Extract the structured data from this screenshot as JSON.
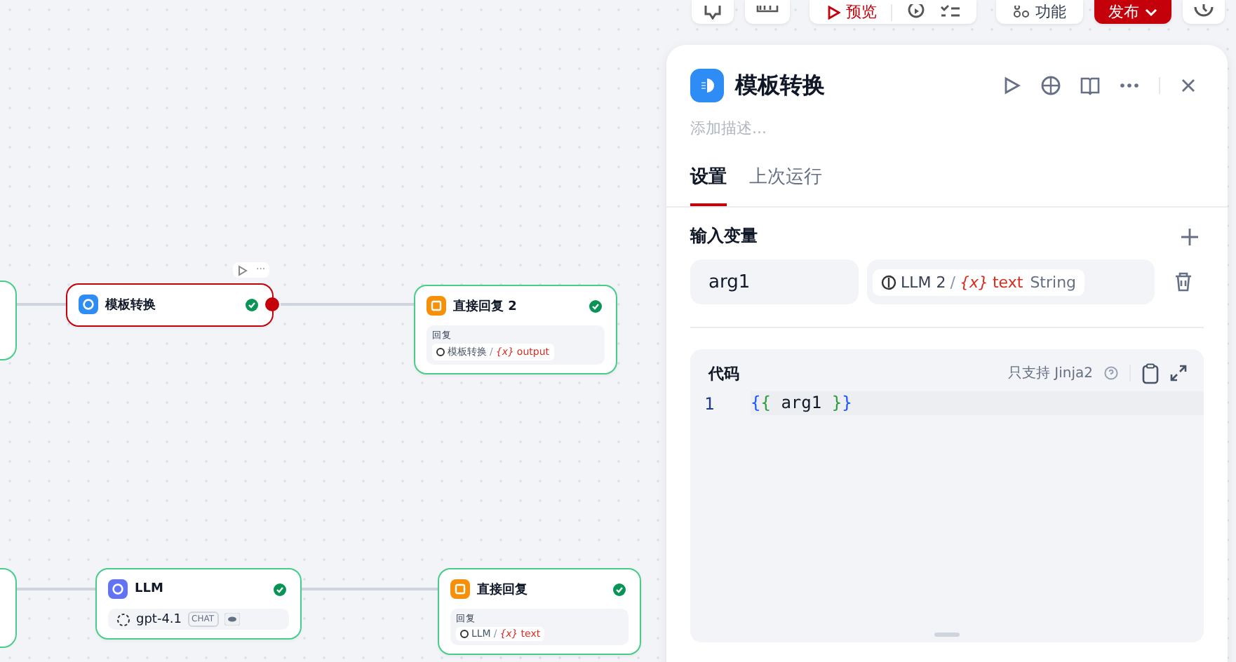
{
  "toolbar": [
    {
      "kind": "chat"
    },
    {
      "kind": "env"
    },
    {
      "kind": "preview",
      "label": "预览"
    },
    {
      "kind": "feature",
      "label": "功能"
    },
    {
      "kind": "publish",
      "label": "发布"
    },
    {
      "kind": "history"
    }
  ],
  "nodes": [
    {
      "title": "模板转换",
      "kind": "template",
      "selected": true,
      "done": true
    },
    {
      "title": "直接回复 2",
      "kind": "reply",
      "selected": false,
      "done": true,
      "field_label": "回复",
      "ref": {
        "source": "模板转换",
        "separator": "/",
        "mark": "{x}",
        "var": "output"
      }
    },
    {
      "title": "LLM",
      "kind": "llm",
      "selected": false,
      "done": true,
      "model": "gpt-4.1",
      "badge": "CHAT"
    },
    {
      "title": "直接回复",
      "kind": "reply",
      "selected": false,
      "done": true,
      "field_label": "回复",
      "ref": {
        "source": "LLM",
        "separator": "/",
        "mark": "{x}",
        "var": "text"
      }
    }
  ],
  "node_toolbar": {
    "more": "···"
  },
  "panel": {
    "title": "模板转换",
    "description_placeholder": "添加描述...",
    "tabs": [
      {
        "label": "设置",
        "selected": true
      },
      {
        "label": "上次运行",
        "selected": false
      }
    ],
    "inputs_title": "输入变量",
    "inputs": [
      {
        "name": "arg1",
        "source": "LLM 2",
        "separator": "/",
        "mark": "{x}",
        "var": "text",
        "type": "String"
      }
    ],
    "code": {
      "title": "代码",
      "hint": "只支持 Jinja2",
      "lines": [
        {
          "number": "1",
          "open": "{{",
          "body": " arg1 ",
          "close": "}}"
        }
      ]
    }
  }
}
